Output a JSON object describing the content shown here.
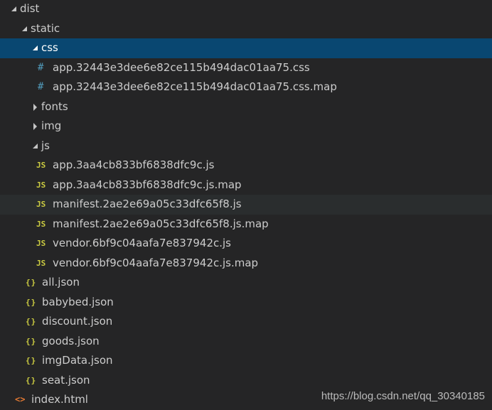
{
  "explorer": {
    "items": [
      {
        "label": "dist",
        "type": "folder",
        "depth": 0,
        "expanded": true,
        "icon": "chevron-down-icon"
      },
      {
        "label": "static",
        "type": "folder",
        "depth": 1,
        "expanded": true,
        "icon": "chevron-down-icon"
      },
      {
        "label": "css",
        "type": "folder",
        "depth": 2,
        "expanded": true,
        "selected": true,
        "icon": "chevron-down-icon"
      },
      {
        "label": "app.32443e3dee6e82ce115b494dac01aa75.css",
        "type": "css",
        "depth": 3,
        "icon": "css-file-icon",
        "glyph": "#"
      },
      {
        "label": "app.32443e3dee6e82ce115b494dac01aa75.css.map",
        "type": "css",
        "depth": 3,
        "icon": "css-file-icon",
        "glyph": "#"
      },
      {
        "label": "fonts",
        "type": "folder",
        "depth": 2,
        "expanded": false,
        "icon": "chevron-right-icon"
      },
      {
        "label": "img",
        "type": "folder",
        "depth": 2,
        "expanded": false,
        "icon": "chevron-right-icon"
      },
      {
        "label": "js",
        "type": "folder",
        "depth": 2,
        "expanded": true,
        "icon": "chevron-down-icon"
      },
      {
        "label": "app.3aa4cb833bf6838dfc9c.js",
        "type": "js",
        "depth": 3,
        "icon": "js-file-icon",
        "glyph": "JS"
      },
      {
        "label": "app.3aa4cb833bf6838dfc9c.js.map",
        "type": "js",
        "depth": 3,
        "icon": "js-file-icon",
        "glyph": "JS"
      },
      {
        "label": "manifest.2ae2e69a05c33dfc65f8.js",
        "type": "js",
        "depth": 3,
        "hover": true,
        "icon": "js-file-icon",
        "glyph": "JS"
      },
      {
        "label": "manifest.2ae2e69a05c33dfc65f8.js.map",
        "type": "js",
        "depth": 3,
        "icon": "js-file-icon",
        "glyph": "JS"
      },
      {
        "label": "vendor.6bf9c04aafa7e837942c.js",
        "type": "js",
        "depth": 3,
        "icon": "js-file-icon",
        "glyph": "JS"
      },
      {
        "label": "vendor.6bf9c04aafa7e837942c.js.map",
        "type": "js",
        "depth": 3,
        "icon": "js-file-icon",
        "glyph": "JS"
      },
      {
        "label": "all.json",
        "type": "json",
        "depth": 2,
        "icon": "json-file-icon",
        "glyph": "{}"
      },
      {
        "label": "babybed.json",
        "type": "json",
        "depth": 2,
        "icon": "json-file-icon",
        "glyph": "{}"
      },
      {
        "label": "discount.json",
        "type": "json",
        "depth": 2,
        "icon": "json-file-icon",
        "glyph": "{}"
      },
      {
        "label": "goods.json",
        "type": "json",
        "depth": 2,
        "icon": "json-file-icon",
        "glyph": "{}"
      },
      {
        "label": "imgData.json",
        "type": "json",
        "depth": 2,
        "icon": "json-file-icon",
        "glyph": "{}"
      },
      {
        "label": "seat.json",
        "type": "json",
        "depth": 2,
        "icon": "json-file-icon",
        "glyph": "{}"
      },
      {
        "label": "index.html",
        "type": "html",
        "depth": 1,
        "icon": "html-file-icon",
        "glyph": "<>"
      }
    ]
  },
  "watermark": "https://blog.csdn.net/qq_30340185",
  "colors": {
    "background": "#252526",
    "selected": "#094771",
    "hover": "#2a2d2e",
    "css_icon": "#519aba",
    "js_icon": "#cbcb41",
    "json_icon": "#cbcb41",
    "html_icon": "#e37933"
  }
}
